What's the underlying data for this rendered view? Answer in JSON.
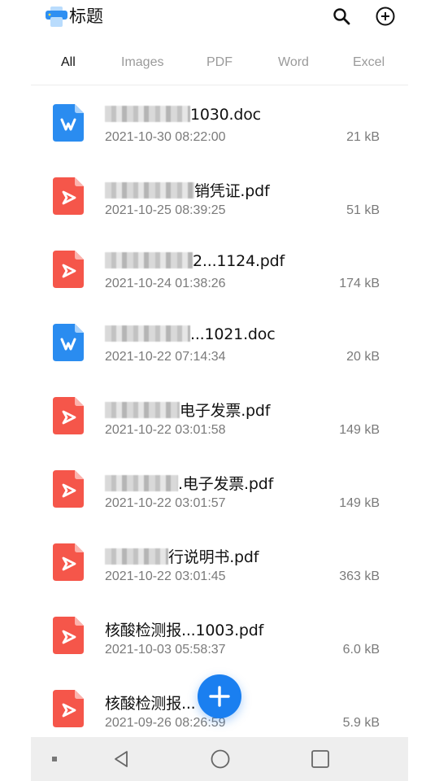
{
  "header": {
    "app_icon": "printer-icon",
    "title": "标题",
    "search_icon": "search-icon",
    "add_icon": "add-circle-icon"
  },
  "tabs": [
    {
      "label": "All",
      "active": true
    },
    {
      "label": "Images",
      "active": false
    },
    {
      "label": "PDF",
      "active": false
    },
    {
      "label": "Word",
      "active": false
    },
    {
      "label": "Excel",
      "active": false
    }
  ],
  "files": [
    {
      "type": "doc",
      "icon": "word-file-icon",
      "name_suffix": "1030.doc",
      "date": "2021-10-30 08:22:00",
      "size": "21 kB"
    },
    {
      "type": "pdf",
      "icon": "pdf-file-icon",
      "name_suffix": "销凭证.pdf",
      "date": "2021-10-25 08:39:25",
      "size": "51 kB"
    },
    {
      "type": "pdf",
      "icon": "pdf-file-icon",
      "name_suffix": "2...1124.pdf",
      "date": "2021-10-24 01:38:26",
      "size": "174 kB"
    },
    {
      "type": "doc",
      "icon": "word-file-icon",
      "name_suffix": "...1021.doc",
      "date": "2021-10-22 07:14:34",
      "size": "20 kB"
    },
    {
      "type": "pdf",
      "icon": "pdf-file-icon",
      "name_suffix": "电子发票.pdf",
      "date": "2021-10-22 03:01:58",
      "size": "149 kB"
    },
    {
      "type": "pdf",
      "icon": "pdf-file-icon",
      "name_suffix": ".电子发票.pdf",
      "date": "2021-10-22 03:01:57",
      "size": "149 kB"
    },
    {
      "type": "pdf",
      "icon": "pdf-file-icon",
      "name_suffix": "行说明书.pdf",
      "date": "2021-10-22 03:01:45",
      "size": "363 kB"
    },
    {
      "type": "pdf",
      "icon": "pdf-file-icon",
      "name_suffix": "核酸检测报...1003.pdf",
      "date": "2021-10-03 05:58:37",
      "size": "6.0 kB"
    },
    {
      "type": "pdf",
      "icon": "pdf-file-icon",
      "name_suffix": "核酸检测报...  .pdf",
      "date": "2021-09-26 08:26:59",
      "size": "5.9 kB"
    }
  ],
  "fab": {
    "icon": "plus-icon"
  },
  "navbar": {
    "back_icon": "back-triangle-icon",
    "home_icon": "home-circle-icon",
    "recents_icon": "recents-square-icon"
  },
  "colors": {
    "accent": "#1a7ff0",
    "pdf_red": "#f5564a",
    "word_blue": "#2a8cf0",
    "tab_inactive": "#9a9a9a"
  }
}
